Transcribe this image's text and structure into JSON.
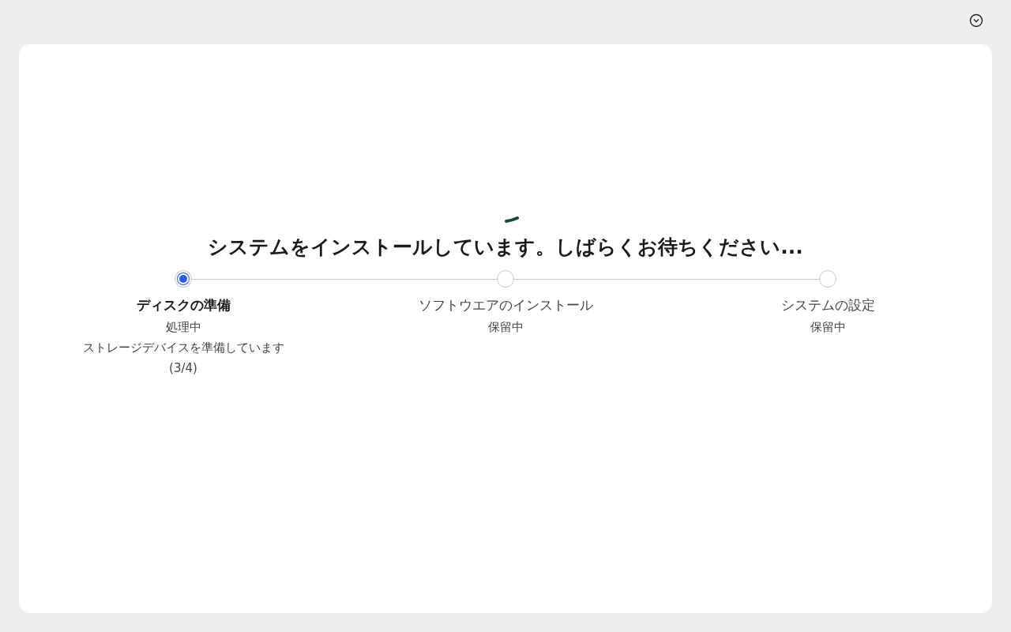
{
  "heading": "システムをインストールしています。しばらくお待ちください...",
  "steps": [
    {
      "title": "ディスクの準備",
      "status": "処理中",
      "active": true,
      "detail": "ストレージデバイスを準備しています",
      "progress": "(3/4)"
    },
    {
      "title": "ソフトウエアのインストール",
      "status": "保留中",
      "active": false
    },
    {
      "title": "システムの設定",
      "status": "保留中",
      "active": false
    }
  ]
}
